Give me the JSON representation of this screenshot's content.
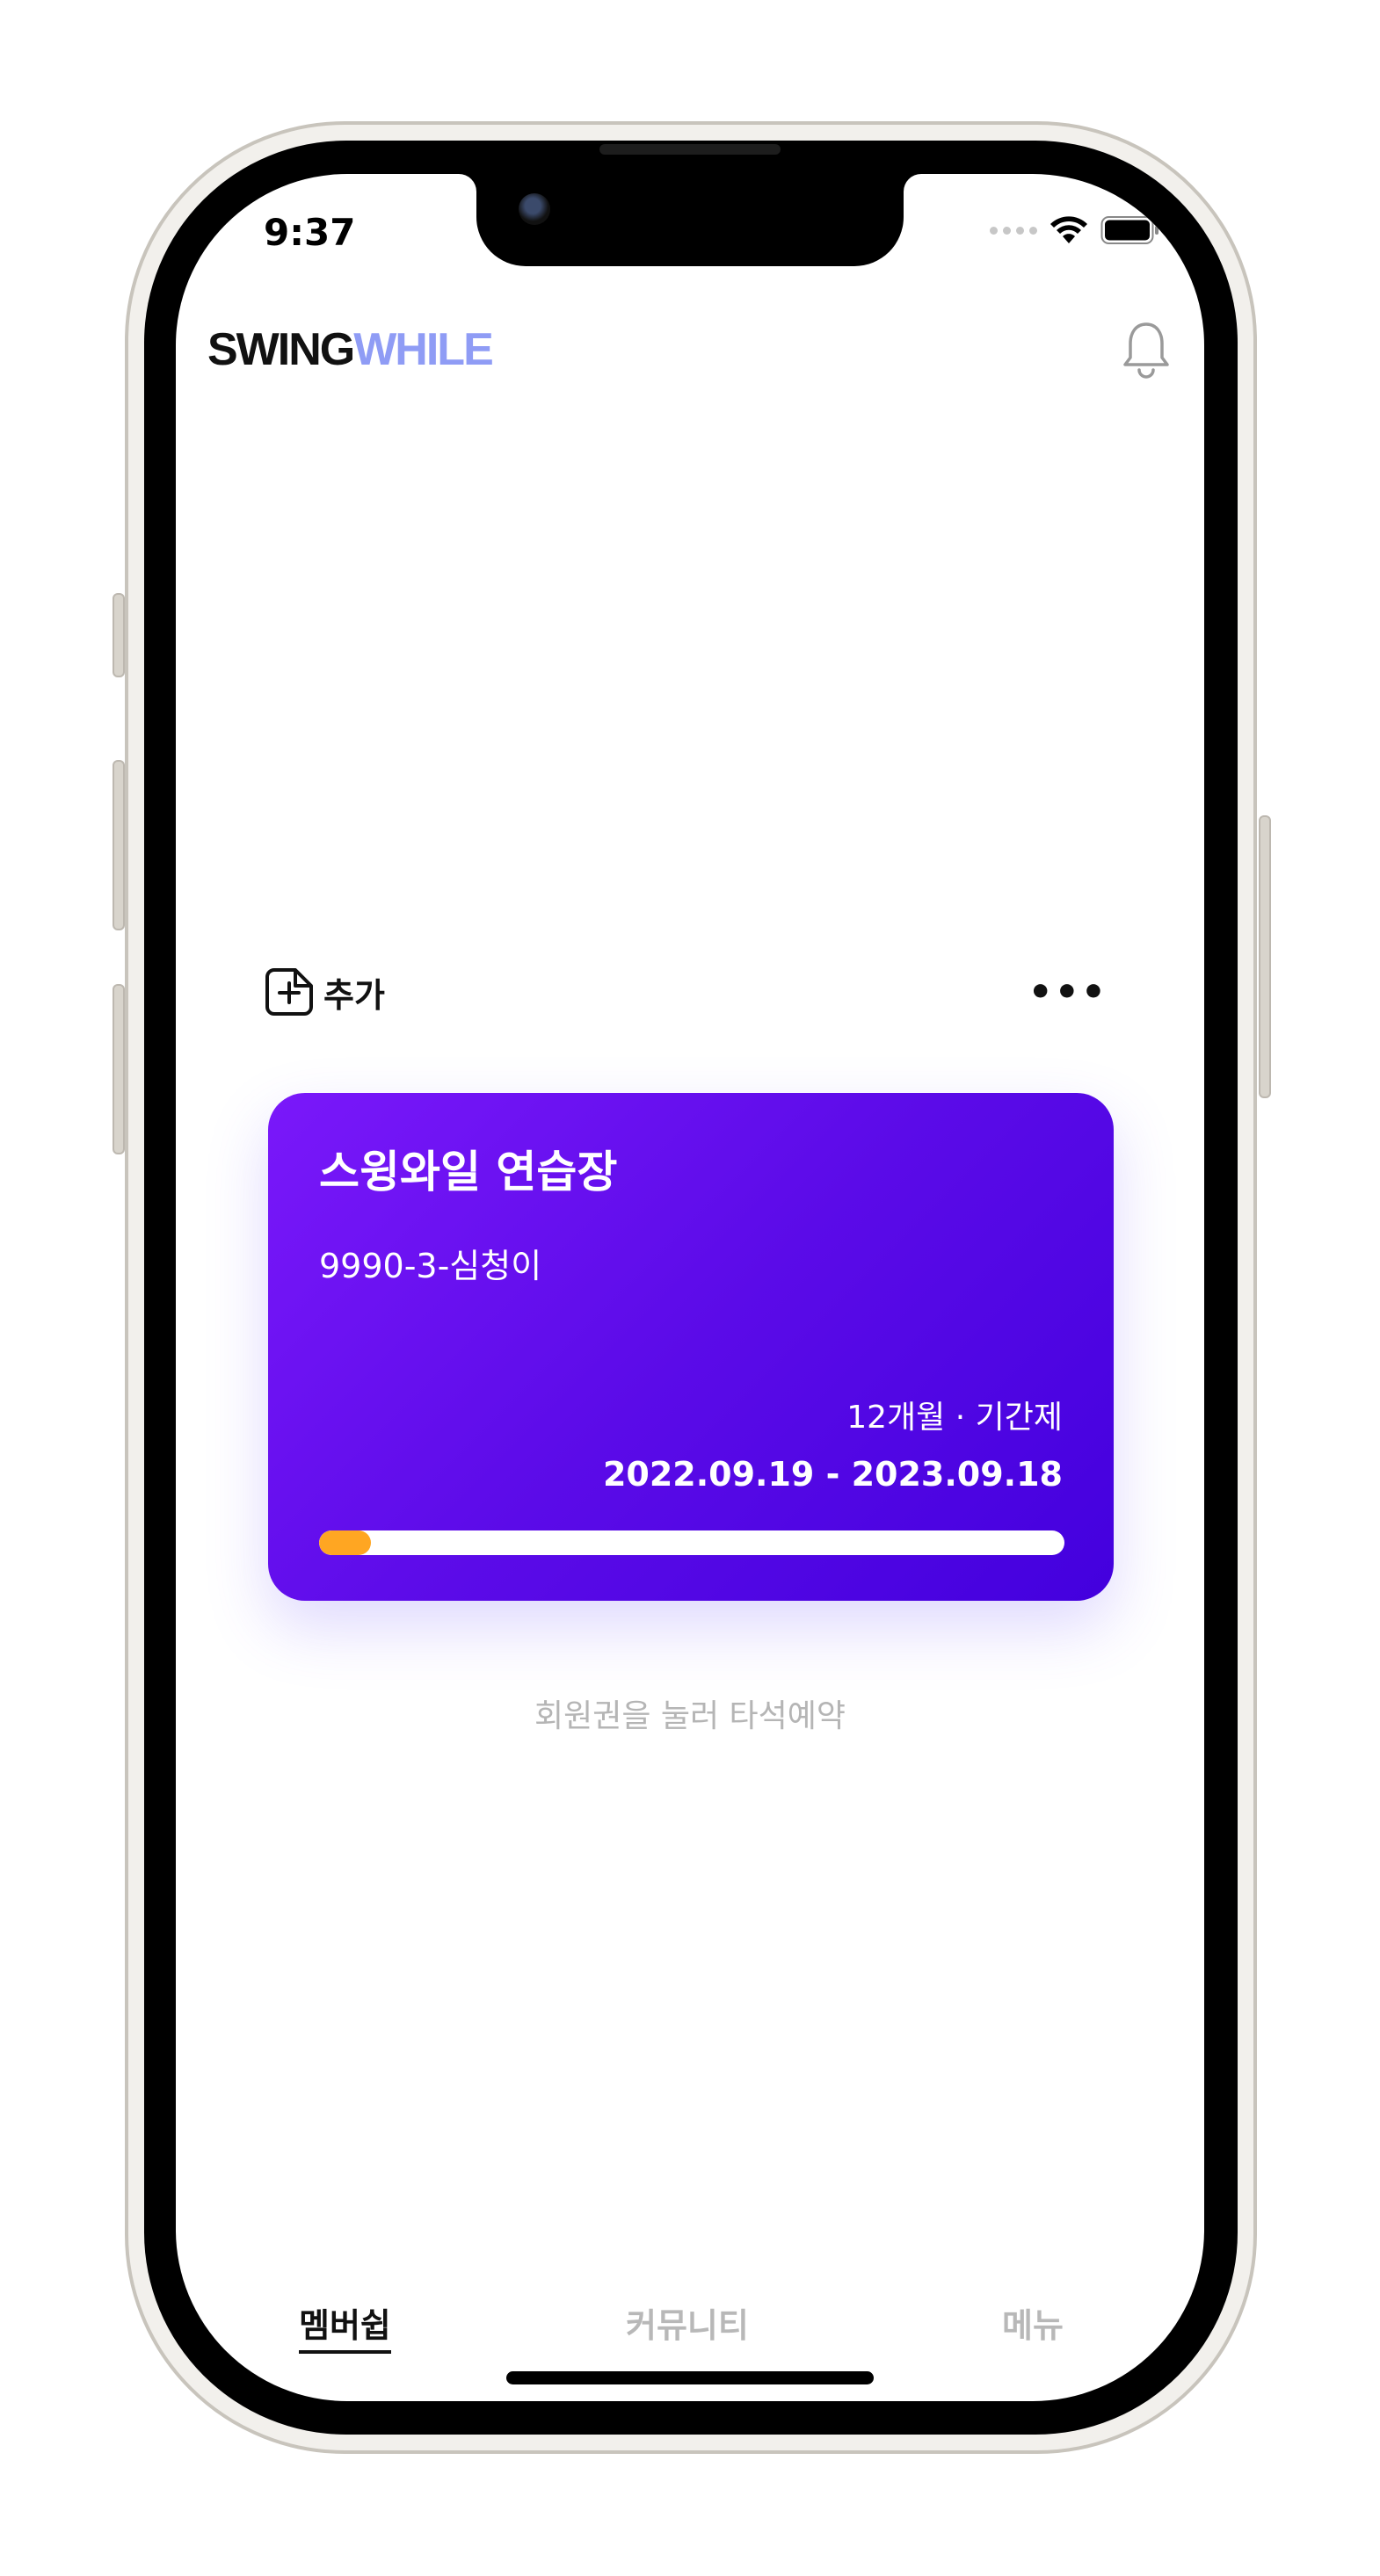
{
  "status_bar": {
    "time": "9:37"
  },
  "header": {
    "logo_part1": "SWING",
    "logo_part2": "WHILE",
    "logo_color1": "#111111",
    "logo_color2": "#8f9cf5",
    "notification_icon": "bell-icon"
  },
  "actions": {
    "add_label": "추가",
    "add_icon": "document-plus-icon",
    "more_label": "•••"
  },
  "membership_card": {
    "title": "스윙와일 연습장",
    "member_code": "9990-3-심청이",
    "plan": "12개월 · 기간제",
    "period": "2022.09.19 - 2023.09.18",
    "progress": 0.07,
    "progress_color": "#ffa622",
    "gradient_start": "#7a18fa",
    "gradient_end": "#4300de"
  },
  "hint": "회원권을 눌러 타석예약",
  "tabs": [
    {
      "label": "멤버쉽",
      "active": true
    },
    {
      "label": "커뮤니티",
      "active": false
    },
    {
      "label": "메뉴",
      "active": false
    }
  ]
}
